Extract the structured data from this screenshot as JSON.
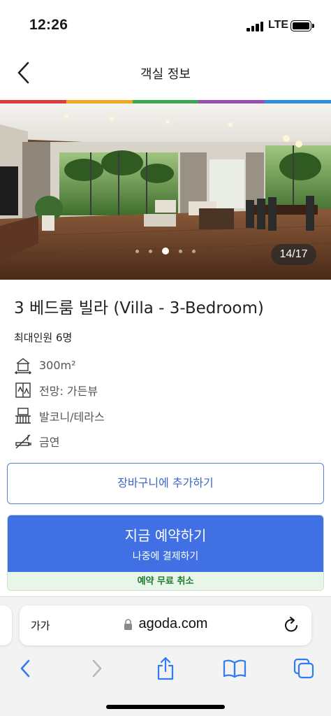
{
  "status_bar": {
    "time": "12:26",
    "network": "LTE",
    "signal_bars_active": 4,
    "battery_level": 1.0
  },
  "header": {
    "title": "객실 정보",
    "back_icon": "chevron-left-icon"
  },
  "brand_stripe": [
    "#e23b3b",
    "#f2a81d",
    "#3aa757",
    "#9b4fb0",
    "#2e8fe0"
  ],
  "gallery": {
    "counter": "14/17",
    "dots_total": 5,
    "dots_active_index": 2
  },
  "room": {
    "title": "3 베드룸 빌라 (Villa - 3-Bedroom)",
    "max_guests": "최대인원 6명",
    "features": [
      {
        "icon": "room-size-icon",
        "text": "300m²"
      },
      {
        "icon": "view-icon",
        "text": "전망: 가든뷰"
      },
      {
        "icon": "balcony-icon",
        "text": "발코니/테라스"
      },
      {
        "icon": "no-smoking-icon",
        "text": "금연"
      }
    ]
  },
  "actions": {
    "add_to_cart": "장바구니에 추가하기",
    "book_now": "지금 예약하기",
    "pay_later": "나중에 결제하기",
    "free_cancellation": "예약 무료 취소"
  },
  "colors": {
    "primary": "#4070e3",
    "cart_border": "#5a80d6",
    "free_cancel_bg": "#e8f6e9",
    "free_cancel_text": "#1f7a2e",
    "safari_blue": "#2f7cf6"
  },
  "browser": {
    "text_size_button": "가가",
    "url": "agoda.com",
    "toolbar_icons": [
      "back-icon",
      "forward-icon",
      "share-icon",
      "bookmarks-icon",
      "tabs-icon"
    ]
  }
}
